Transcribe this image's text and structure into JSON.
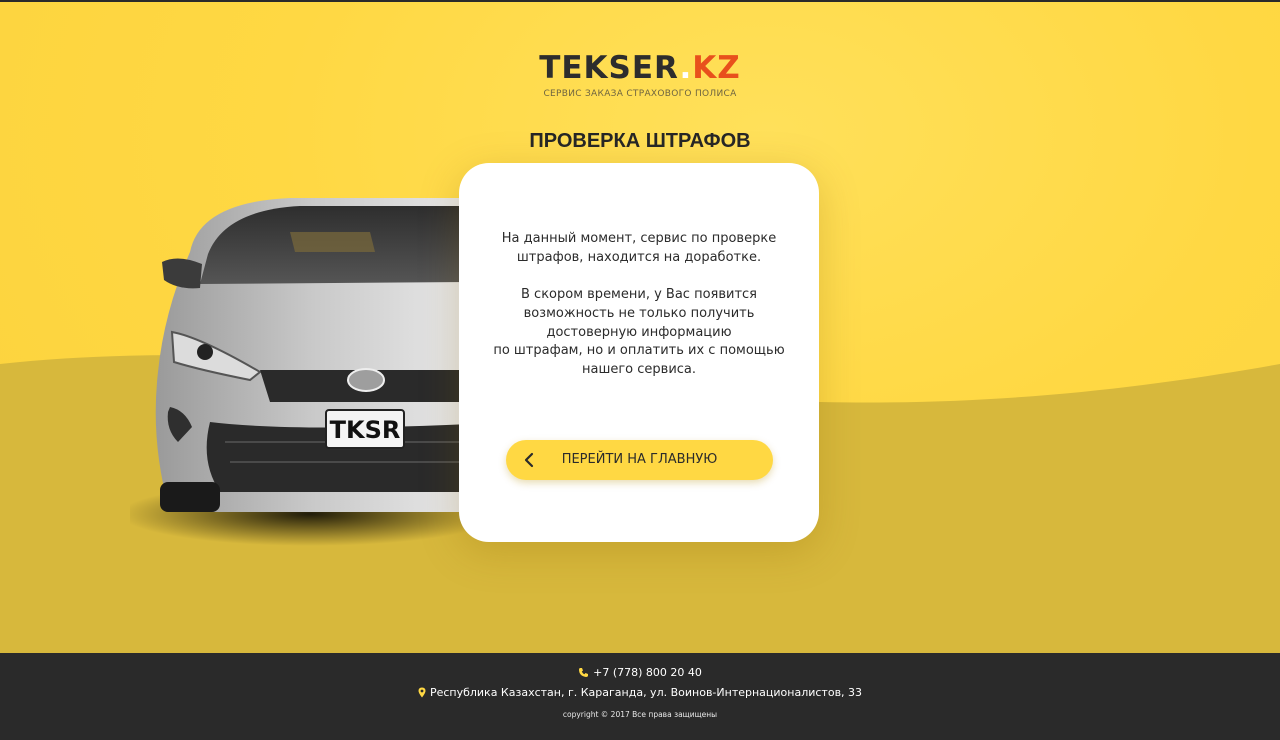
{
  "brand": {
    "name": "TEKSER",
    "dot": ".",
    "tld": "KZ",
    "tagline": "СЕРВИС ЗАКАЗА СТРАХОВОГО ПОЛИСА",
    "accent_color": "#ffd843",
    "tld_color": "#e8501c"
  },
  "page": {
    "title": "ПРОВЕРКА ШТРАФОВ"
  },
  "card": {
    "paragraph1_line1": "На данный момент, сервис по проверке",
    "paragraph1_line2": "штрафов, находится на доработке.",
    "paragraph2_line1": "В скором времени, у Вас появится",
    "paragraph2_line2": "возможность не только получить",
    "paragraph2_line3": "достоверную информацию",
    "paragraph2_line4": "по штрафам, но и оплатить их с помощью",
    "paragraph2_line5": "нашего сервиса.",
    "back_button_label": "ПЕРЕЙТИ НА ГЛАВНУЮ",
    "back_button_icon": "chevron-left-icon"
  },
  "car": {
    "plate": "TKSR"
  },
  "footer": {
    "phone": "+7 (778) 800 20 40",
    "phone_icon": "phone-icon",
    "address": "Республика Казахстан, г. Караганда, ул. Воинов-Интернационалистов, 33",
    "address_icon": "map-pin-icon",
    "copyright": "copyright © 2017 Все права защищены"
  }
}
